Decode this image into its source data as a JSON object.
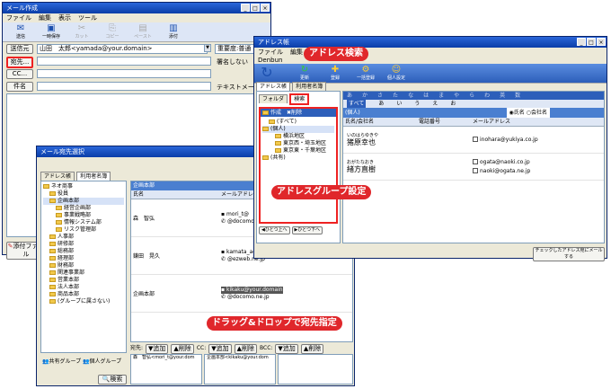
{
  "mail": {
    "title": "メール作成",
    "menu": [
      "ファイル",
      "編集",
      "表示",
      "ツール"
    ],
    "toolbar": [
      {
        "icon": "envelope-icon",
        "glyph": "✉",
        "label": "送信"
      },
      {
        "icon": "save-icon",
        "glyph": "▣",
        "label": "一時保存"
      },
      {
        "icon": "cut-icon",
        "glyph": "✂",
        "label": "カット"
      },
      {
        "icon": "copy-icon",
        "glyph": "⎘",
        "label": "コピー"
      },
      {
        "icon": "paste-icon",
        "glyph": "▤",
        "label": "ペースト"
      },
      {
        "icon": "attach-icon",
        "glyph": "▥",
        "label": "添付"
      }
    ],
    "from_label": "送信元",
    "from_value": "山田　太郎<yamada@your.domain>",
    "to_label": "宛先...",
    "cc_label": "CC...",
    "subject_label": "件名",
    "importance_label": "重要度:普通",
    "signature_label": "署名しない",
    "textmail_label": "テキストメール",
    "attach_label": "添付ファイル"
  },
  "dest": {
    "title": "メール宛先選択",
    "tabs": [
      "アドレス帳",
      "利用者名簿"
    ],
    "tree": [
      {
        "label": "ネオ商事",
        "level": 0
      },
      {
        "label": "役員",
        "level": 1
      },
      {
        "label": "企画本部",
        "level": 1
      },
      {
        "label": "経営企画部",
        "level": 2
      },
      {
        "label": "事業戦略部",
        "level": 2
      },
      {
        "label": "情報システム部",
        "level": 2
      },
      {
        "label": "リスク管理部",
        "level": 2
      },
      {
        "label": "人事部",
        "level": 1
      },
      {
        "label": "研修部",
        "level": 1
      },
      {
        "label": "総務部",
        "level": 1
      },
      {
        "label": "経理部",
        "level": 1
      },
      {
        "label": "財務部",
        "level": 1
      },
      {
        "label": "関連事業部",
        "level": 1
      },
      {
        "label": "営業本部",
        "level": 1
      },
      {
        "label": "法人本部",
        "level": 1
      },
      {
        "label": "商品本部",
        "level": 1
      },
      {
        "label": "(グループに属さない)",
        "level": 1
      }
    ],
    "shared_group": "共有グループ",
    "personal_group": "個人グループ",
    "search_button": "検索",
    "list_header": "企画本部",
    "col_name": "氏名",
    "col_mail": "メールアドレス",
    "rows": [
      {
        "name": "森　智弘",
        "mails": [
          "mori_t@",
          "@docomo.n"
        ]
      },
      {
        "name": "鎌田　晃久",
        "mails": [
          "kamata_a@",
          "@ezweb.ne.jp"
        ]
      },
      {
        "name": "企画本部",
        "mails": [
          "kikaku@your.domain",
          "@docomo.ne.jp"
        ]
      }
    ],
    "to_label": "宛先:",
    "cc_label": "CC:",
    "bcc_label": "BCC:",
    "add_button": "追加",
    "remove_button": "削除",
    "to_value": "森　智弘<mori_t@your.dom",
    "cc_value": "企画本部<kikaku@your.dom"
  },
  "addr": {
    "title": "アドレス帳",
    "menu": [
      "ファイル",
      "編集",
      "表示"
    ],
    "toolbar_title": "Denbun",
    "toolbar": [
      {
        "icon": "refresh-icon",
        "glyph": "↻",
        "label": "更新"
      },
      {
        "icon": "register-icon",
        "glyph": "✚",
        "label": "登録"
      },
      {
        "icon": "settings-icon",
        "glyph": "⚙",
        "label": "一括登録"
      },
      {
        "icon": "user-settings-icon",
        "glyph": "☺",
        "label": "個人設定"
      }
    ],
    "tabs": [
      "アドレス帳",
      "利用者名簿"
    ],
    "folder_tabs": [
      "フォルダ",
      "検索"
    ],
    "tree_toolbar": [
      "作成",
      "削除"
    ],
    "tree": [
      {
        "label": "(すべて)",
        "level": 1
      },
      {
        "label": "(個人)",
        "level": 0
      },
      {
        "label": "横浜地区",
        "level": 2
      },
      {
        "label": "東京西・埼玉地区",
        "level": 2
      },
      {
        "label": "東京東・千葉地区",
        "level": 2
      },
      {
        "label": "(共有)",
        "level": 0
      }
    ],
    "nav_up": "ひとつ上へ",
    "nav_down": "ひとつ下へ",
    "kana_row1": [
      "あ",
      "か",
      "さ",
      "た",
      "な",
      "は",
      "ま",
      "や",
      "ら",
      "わ",
      "英",
      "数"
    ],
    "kana_row2": [
      "すべて",
      "あ",
      "い",
      "う",
      "え",
      "お"
    ],
    "list_header": "(個人)",
    "radio_name": "氏名",
    "radio_company": "会社名",
    "col_name": "氏名/会社名",
    "col_phone": "電話番号",
    "col_mail": "メールアドレス",
    "rows": [
      {
        "kana": "いのはらゆきや",
        "name": "猪原幸也",
        "mails": [
          "inohara@yukiya.co.jp"
        ]
      },
      {
        "kana": "おがたなおき",
        "name": "緒方直樹",
        "mails": [
          "ogata@naoki.co.jp",
          "naoki@ogata.ne.jp"
        ]
      }
    ],
    "send_button": "チェックしたアドレス宛にメールする"
  },
  "callouts": {
    "search": "アドレス検索",
    "group": "アドレスグループ設定",
    "drag": "ドラッグ&ドロップで宛先指定"
  }
}
